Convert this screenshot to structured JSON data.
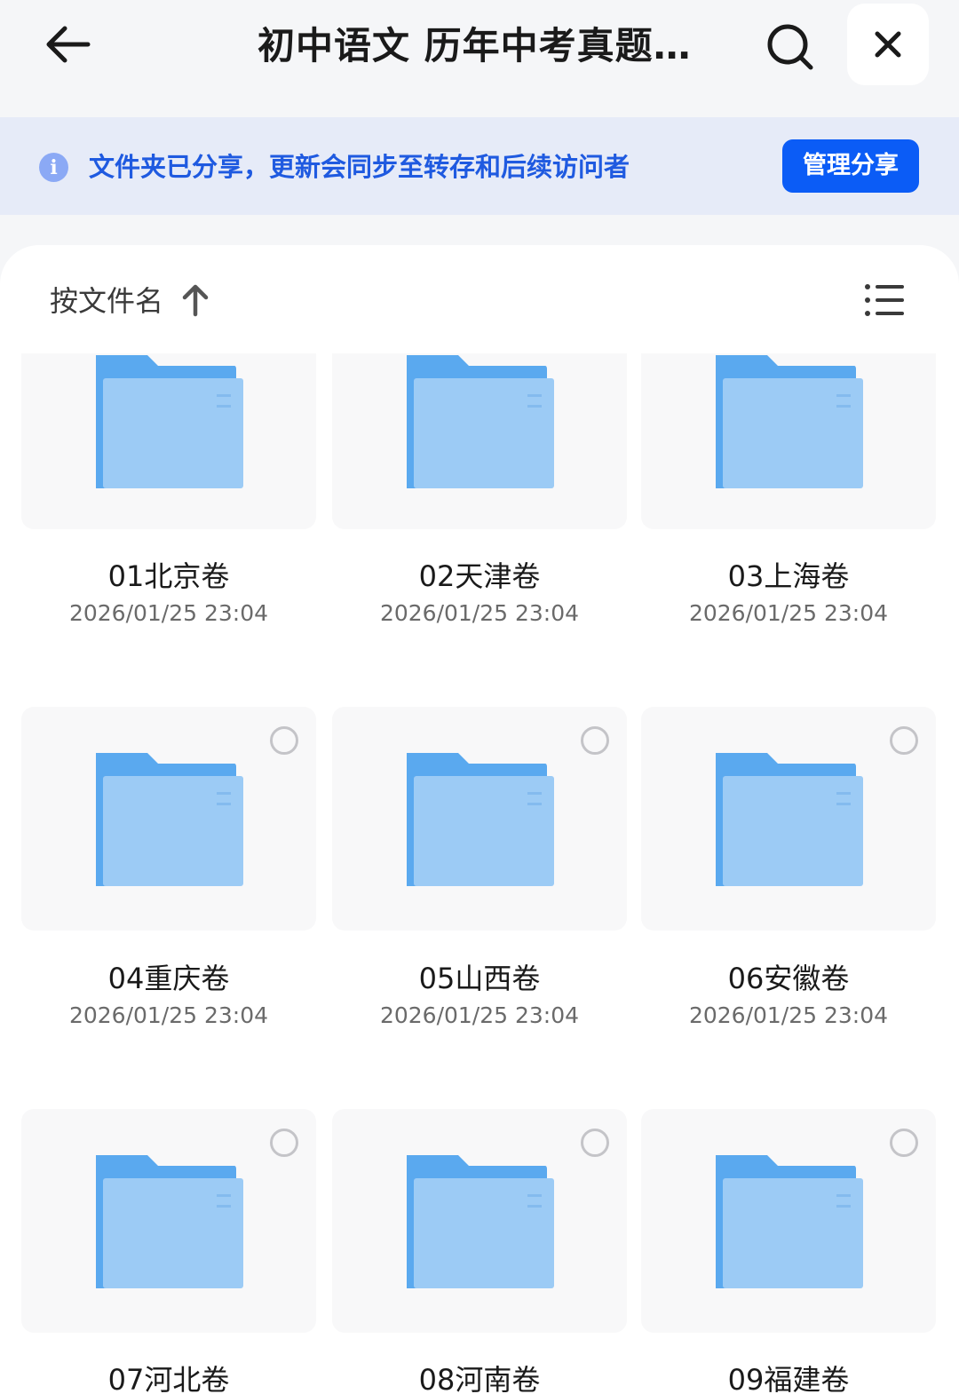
{
  "header": {
    "title": "初中语文 历年中考真题…",
    "back_icon": "arrow-left-icon",
    "search_icon": "search-icon",
    "close_icon": "close-icon"
  },
  "banner": {
    "icon": "info-icon",
    "info_glyph": "i",
    "message": "文件夹已分享，更新会同步至转存和后续访问者",
    "manage_label": "管理分享"
  },
  "toolbar": {
    "sort_label": "按文件名",
    "sort_icon": "arrow-up-icon",
    "view_icon": "list-view-icon"
  },
  "colors": {
    "accent": "#0b5cf6",
    "banner_text": "#1f5ae0",
    "banner_bg": "#e6ebf8",
    "folder_back": "#5aa9ef",
    "folder_front": "#9ccbf5"
  },
  "items": [
    {
      "name": "01北京卷",
      "date": "2026/01/25 23:04"
    },
    {
      "name": "02天津卷",
      "date": "2026/01/25 23:04"
    },
    {
      "name": "03上海卷",
      "date": "2026/01/25 23:04"
    },
    {
      "name": "04重庆卷",
      "date": "2026/01/25 23:04"
    },
    {
      "name": "05山西卷",
      "date": "2026/01/25 23:04"
    },
    {
      "name": "06安徽卷",
      "date": "2026/01/25 23:04"
    },
    {
      "name": "07河北卷",
      "date": ""
    },
    {
      "name": "08河南卷",
      "date": ""
    },
    {
      "name": "09福建卷",
      "date": ""
    }
  ]
}
